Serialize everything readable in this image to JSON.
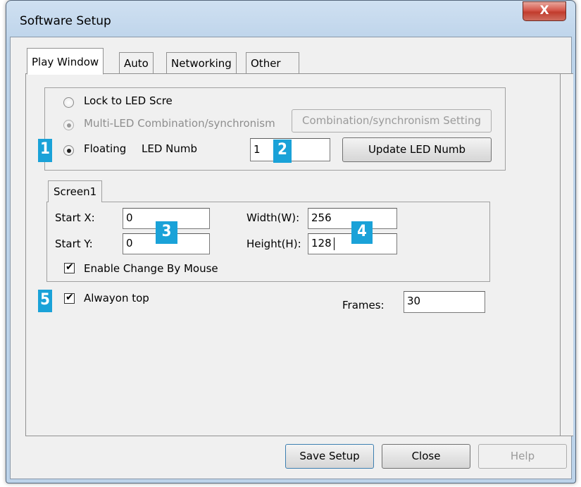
{
  "window": {
    "title": "Software Setup",
    "close_glyph": "X"
  },
  "tabs": [
    {
      "label": "Play Window",
      "active": true
    },
    {
      "label": "Auto",
      "active": false
    },
    {
      "label": "Networking",
      "active": false
    },
    {
      "label": "Other",
      "active": false
    }
  ],
  "play_window": {
    "mode_options": [
      {
        "label": "Lock to LED Scre",
        "checked": false,
        "enabled": true
      },
      {
        "label": "Multi-LED Combination/synchronism",
        "checked": true,
        "enabled": false
      },
      {
        "label": "Floating",
        "checked": true,
        "enabled": true
      }
    ],
    "combination_button": "Combination/synchronism Setting",
    "led_numb_label": "LED Numb",
    "led_numb_value": "1",
    "update_button": "Update LED Numb"
  },
  "screen": {
    "tab_label": "Screen1",
    "start_x_label": "Start X:",
    "start_x_value": "0",
    "start_y_label": "Start Y:",
    "start_y_value": "0",
    "width_label": "Width(W):",
    "width_value": "256",
    "height_label": "Height(H):",
    "height_value": "128",
    "enable_mouse_label": "Enable Change By Mouse",
    "enable_mouse_checked": true
  },
  "always_on_top": {
    "label": "Alwayon top",
    "checked": true
  },
  "frames": {
    "label": "Frames:",
    "value": "30"
  },
  "badges": [
    "1",
    "2",
    "3",
    "4",
    "5"
  ],
  "footer": {
    "save": "Save Setup",
    "close": "Close",
    "help": "Help"
  },
  "colors": {
    "badge": "#1aa2d8",
    "close_button": "#c94a3b",
    "frame": "#bcd3ea"
  }
}
